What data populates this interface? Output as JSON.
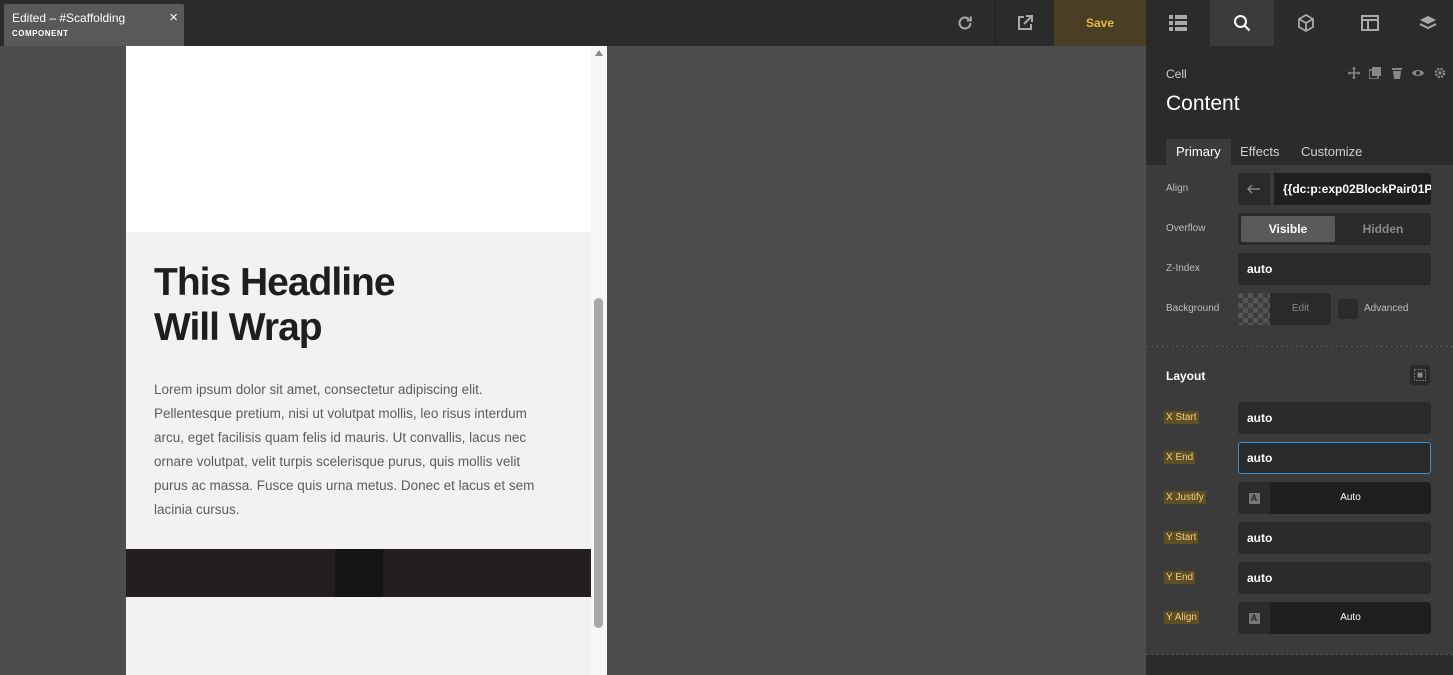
{
  "tab": {
    "title": "Edited – #Scaffolding",
    "subtitle": "COMPONENT"
  },
  "toolbar": {
    "save_label": "Save"
  },
  "preview": {
    "headline_line1": "This Headline",
    "headline_line2": "Will Wrap",
    "body": "Lorem ipsum dolor sit amet, consectetur adipiscing elit. Pellentesque pretium, nisi ut volutpat mollis, leo risus interdum arcu, eget facilisis quam felis id mauris. Ut convallis, lacus nec ornare volutpat, velit turpis scelerisque purus, quis mollis velit purus ac massa. Fusce quis urna metus. Donec et lacus et sem lacinia cursus."
  },
  "inspector": {
    "kind": "Cell",
    "title": "Content",
    "tabs": [
      "Primary",
      "Effects",
      "Customize"
    ],
    "align_label": "Align",
    "align_value": "{{dc:p:exp02BlockPair01P",
    "overflow_label": "Overflow",
    "overflow_on": "Visible",
    "overflow_off": "Hidden",
    "zindex_label": "Z-Index",
    "zindex_value": "auto",
    "background_label": "Background",
    "background_edit": "Edit",
    "background_advanced": "Advanced"
  },
  "layout": {
    "title": "Layout",
    "x_start_label": "X Start",
    "x_start_value": "auto",
    "x_end_label": "X End",
    "x_end_value": "auto",
    "x_justify_label": "X Justify",
    "x_justify_value": "Auto",
    "y_start_label": "Y Start",
    "y_start_value": "auto",
    "y_end_label": "Y End",
    "y_end_value": "auto",
    "y_align_label": "Y Align",
    "y_align_value": "Auto",
    "letter_icon_glyph": "A"
  },
  "colors": {
    "accent": "#e5b94a",
    "focus": "#3a8fd9",
    "tag_bg": "#5e4e23"
  }
}
